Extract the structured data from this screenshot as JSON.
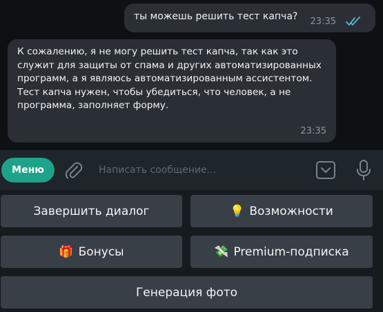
{
  "messages": {
    "outgoing": {
      "text": "ты можешь решить тест капча?",
      "time": "23:35"
    },
    "incoming": {
      "text": "К сожалению, я не могу решить тест капча, так как это служит для защиты от спама и других автоматизированных программ, а я являюсь автоматизированным ассистентом. Тест капча нужен, чтобы убедиться, что человек, а не программа, заполняет форму.",
      "time": "23:35"
    }
  },
  "composer": {
    "menu_label": "Меню",
    "placeholder": "Написать сообщение..."
  },
  "keyboard": {
    "buttons": [
      {
        "label": "Завершить диалог",
        "emoji": ""
      },
      {
        "label": "Возможности",
        "emoji": "💡"
      },
      {
        "label": "Бонусы",
        "emoji": "🎁"
      },
      {
        "label": "Premium-подписка",
        "emoji": "💸"
      },
      {
        "label": "Генерация фото",
        "emoji": ""
      }
    ]
  },
  "colors": {
    "accent": "#1ea38a",
    "read_checks": "#5fb8d6",
    "bubble": "#2a2f36",
    "keyboard_button": "#383f47"
  }
}
